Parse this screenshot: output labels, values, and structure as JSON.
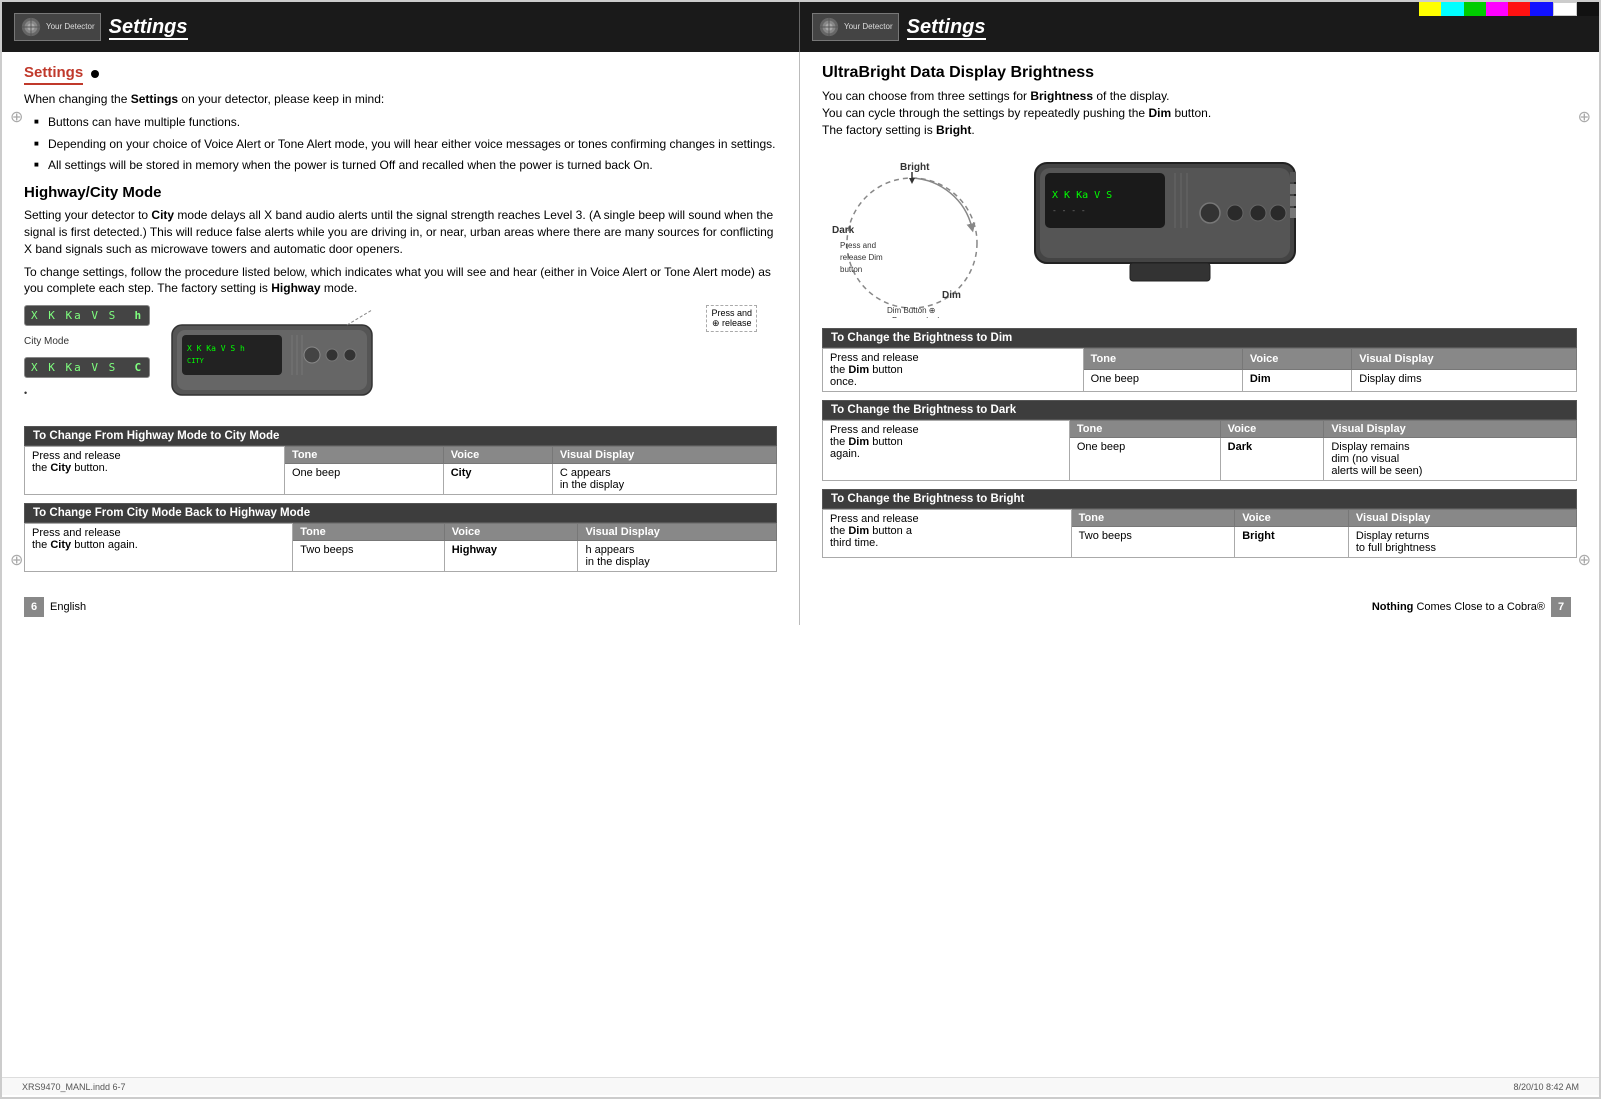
{
  "meta": {
    "file_name": "XRS9470_MANL.indd 6-7",
    "print_date": "8/20/10  8:42 AM",
    "page_left_num": "6",
    "page_right_num": "7"
  },
  "color_bars": [
    "#ffff00",
    "#00ffff",
    "#00ff00",
    "#ff00ff",
    "#ff0000",
    "#0000ff",
    "#ffffff",
    "#000000"
  ],
  "header": {
    "detector_label": "Your Detector",
    "title": "Settings"
  },
  "left_page": {
    "section1": {
      "heading": "Settings",
      "intro": "When changing the Settings on your detector, please keep in mind:",
      "bullets": [
        "Buttons can have multiple functions.",
        "Depending on your choice of Voice Alert or Tone Alert mode, you will hear either voice messages or tones confirming changes in settings.",
        "All settings will be stored in memory when the power is turned Off and recalled when the power is turned back On."
      ]
    },
    "section2": {
      "heading": "Highway/City Mode",
      "body1": "Setting your detector to City mode delays all X band audio alerts until the signal strength reaches Level 3. (A single beep will sound when the signal is first detected.) This will reduce false alerts while you are driving in, or near, urban areas where there are many sources for conflicting X band signals such as microwave towers and automatic door openers.",
      "body2": "To change settings, follow the procedure listed below, which indicates what you will see and hear (either in Voice Alert or Tone Alert mode) as you complete each step. The factory setting is Highway mode.",
      "press_release_label": "Press and\n⊕ release",
      "city_mode_label": "City Mode",
      "display1": "X K Ka V S  h",
      "display2": "X K Ka V S  C"
    },
    "table1": {
      "caption": "To Change From Highway Mode to City Mode",
      "action": "Press and release the City button.",
      "headers": [
        "Tone",
        "Voice",
        "Visual Display"
      ],
      "rows": [
        [
          "One beep",
          "City",
          "C appears\nin the display"
        ]
      ]
    },
    "table2": {
      "caption": "To Change From City Mode Back to Highway Mode",
      "action": "Press and release the City button again.",
      "headers": [
        "Tone",
        "Voice",
        "Visual Display"
      ],
      "rows": [
        [
          "Two beeps",
          "Highway",
          "h appears\nin the display"
        ]
      ]
    }
  },
  "right_page": {
    "section1": {
      "heading": "UltraBright Data Display Brightness",
      "body": "You can choose from three settings for Brightness of the display.\nYou can cycle through the settings by repeatedly pushing the Dim button.\nThe factory setting is Bright.",
      "labels": {
        "bright": "Bright",
        "dark": "Dark",
        "dim": "Dim",
        "press_release": "Press and\nrelease Dim\nbutton",
        "dim_button": "Dim Button ⊕\nPress and release"
      }
    },
    "table1": {
      "caption": "To Change the Brightness to Dim",
      "action": "Press and release the Dim button once.",
      "headers": [
        "Tone",
        "Voice",
        "Visual Display"
      ],
      "rows": [
        [
          "One beep",
          "Dim",
          "Display dims"
        ]
      ]
    },
    "table2": {
      "caption": "To Change the Brightness to Dark",
      "action": "Press and release the Dim button again.",
      "headers": [
        "Tone",
        "Voice",
        "Visual Display"
      ],
      "rows": [
        [
          "One beep",
          "Dark",
          "Display remains\ndim (no visual\nalerts will be seen)"
        ]
      ]
    },
    "table3": {
      "caption": "To Change the Brightness to Bright",
      "action": "Press and release the Dim button a third time.",
      "headers": [
        "Tone",
        "Voice",
        "Visual Display"
      ],
      "rows": [
        [
          "Two beeps",
          "Bright",
          "Display returns\nto full brightness"
        ]
      ]
    }
  },
  "footer": {
    "left_text": "English",
    "right_text": "Nothing Comes Close to a Cobra®",
    "left_page_num": "6",
    "right_page_num": "7"
  }
}
